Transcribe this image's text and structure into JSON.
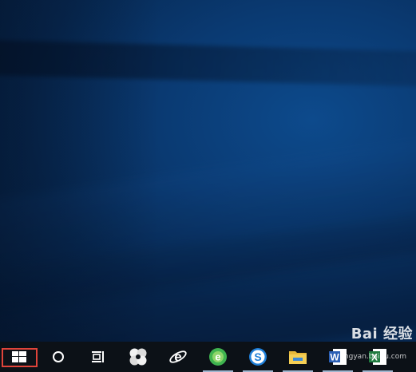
{
  "taskbar": {
    "items": [
      {
        "name": "start-button",
        "icon": "windows-logo-icon",
        "running": false
      },
      {
        "name": "search-button",
        "icon": "cortana-circle-icon",
        "running": false
      },
      {
        "name": "task-view-button",
        "icon": "task-view-icon",
        "running": false
      },
      {
        "name": "app-pinwheel",
        "icon": "pinwheel-icon",
        "running": false
      },
      {
        "name": "app-internet-explorer",
        "icon": "internet-explorer-icon",
        "running": false
      },
      {
        "name": "app-360-browser",
        "icon": "green-browser-icon",
        "running": true
      },
      {
        "name": "app-sogou",
        "icon": "blue-s-browser-icon",
        "running": true
      },
      {
        "name": "app-file-explorer",
        "icon": "folder-icon",
        "running": true
      },
      {
        "name": "app-word",
        "icon": "word-icon",
        "running": true
      },
      {
        "name": "app-excel",
        "icon": "excel-icon",
        "running": true
      }
    ],
    "highlight_color": "#e0443a"
  },
  "watermark": {
    "brand": "Bai 经验",
    "url": "jingyan.baidu.com"
  }
}
